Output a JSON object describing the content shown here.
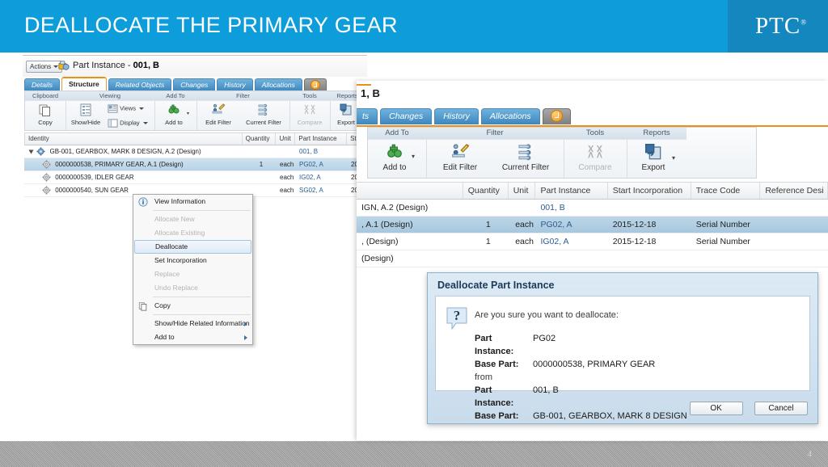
{
  "slide": {
    "title": "DEALLOCATE THE PRIMARY GEAR",
    "logo": "PTC",
    "logo_mark": "®",
    "page_number": "4",
    "banner_color": "#0d9ddb",
    "banner_accent_color": "#1387be",
    "footer_color": "#a6a6a6"
  },
  "background_window": {
    "actions_button": "Actions",
    "page_title_prefix": "Part Instance - ",
    "page_title_object": "001, B",
    "object_icon": "part-instance-icon",
    "tabs": [
      {
        "label": "Details",
        "active": false
      },
      {
        "label": "Structure",
        "active": true
      },
      {
        "label": "Related Objects",
        "active": false
      },
      {
        "label": "Changes",
        "active": false
      },
      {
        "label": "History",
        "active": false
      },
      {
        "label": "Allocations",
        "active": false
      }
    ],
    "tab_overflow_icon": "orange-circle-icon",
    "ribbon_groups": [
      {
        "name": "Clipboard",
        "items": [
          {
            "label": "Copy",
            "icon": "copy-icon",
            "disabled": false,
            "split": false
          }
        ]
      },
      {
        "name": "Viewing",
        "items": [
          {
            "label": "Show/Hide",
            "icon": "show-hide-icon",
            "disabled": false,
            "split": false
          },
          {
            "label": "Views",
            "icon": "views-icon",
            "disabled": false,
            "split": true
          },
          {
            "label": "Display",
            "icon": "display-icon",
            "disabled": false,
            "split": true
          }
        ]
      },
      {
        "name": "Add To",
        "items": [
          {
            "label": "Add to",
            "icon": "add-to-icon",
            "disabled": false,
            "split": true
          }
        ]
      },
      {
        "name": "Filter",
        "items": [
          {
            "label": "Edit Filter",
            "icon": "edit-filter-icon",
            "disabled": false,
            "split": false
          },
          {
            "label": "Current Filter",
            "icon": "current-filter-icon",
            "disabled": false,
            "split": false
          }
        ]
      },
      {
        "name": "Tools",
        "items": [
          {
            "label": "Compare",
            "icon": "compare-icon",
            "disabled": true,
            "split": false
          }
        ]
      },
      {
        "name": "Reports",
        "items": [
          {
            "label": "Export",
            "icon": "export-icon",
            "disabled": false,
            "split": true
          }
        ]
      }
    ],
    "table": {
      "headers": [
        "Identity",
        "Quantity",
        "Unit",
        "Part Instance",
        "Sta"
      ],
      "rows": [
        {
          "identity": "GB-001, GEARBOX, MARK 8 DESIGN, A.2 (Design)",
          "quantity": "",
          "unit": "",
          "part_instance": "001, B",
          "start": "",
          "level": 0,
          "selected": false,
          "expander": true
        },
        {
          "identity": "0000000538, PRIMARY GEAR, A.1 (Design)",
          "quantity": "1",
          "unit": "each",
          "part_instance": "PG02, A",
          "start": "20",
          "level": 1,
          "selected": true,
          "expander": false
        },
        {
          "identity": "0000000539, IDLER GEAR",
          "quantity": "",
          "unit": "each",
          "part_instance": "IG02, A",
          "start": "20",
          "level": 1,
          "selected": false,
          "expander": false
        },
        {
          "identity": "0000000540, SUN GEAR",
          "quantity": "",
          "unit": "each",
          "part_instance": "SG02, A",
          "start": "20",
          "level": 1,
          "selected": false,
          "expander": false
        }
      ]
    }
  },
  "context_menu": {
    "items": [
      {
        "label": "View Information",
        "disabled": false,
        "highlighted": false,
        "icon": "info-icon",
        "submenu": false
      },
      {
        "label": "Allocate New",
        "disabled": true,
        "highlighted": false,
        "icon": "",
        "submenu": false
      },
      {
        "label": "Allocate Existing",
        "disabled": true,
        "highlighted": false,
        "icon": "",
        "submenu": false
      },
      {
        "label": "Deallocate",
        "disabled": false,
        "highlighted": true,
        "icon": "",
        "submenu": false
      },
      {
        "label": "Set Incorporation",
        "disabled": false,
        "highlighted": false,
        "icon": "",
        "submenu": false
      },
      {
        "label": "Replace",
        "disabled": true,
        "highlighted": false,
        "icon": "",
        "submenu": false
      },
      {
        "label": "Undo Replace",
        "disabled": true,
        "highlighted": false,
        "icon": "",
        "submenu": false
      },
      {
        "label": "Copy",
        "disabled": false,
        "highlighted": false,
        "icon": "copy-icon",
        "submenu": false
      },
      {
        "label": "Show/Hide Related Information",
        "disabled": false,
        "highlighted": false,
        "icon": "",
        "submenu": true
      },
      {
        "label": "Add to",
        "disabled": false,
        "highlighted": false,
        "icon": "",
        "submenu": true
      }
    ]
  },
  "foreground_window": {
    "page_title_object": "1, B",
    "tabs": [
      {
        "label": "ts",
        "active": false
      },
      {
        "label": "Changes",
        "active": false
      },
      {
        "label": "History",
        "active": false
      },
      {
        "label": "Allocations",
        "active": false
      }
    ],
    "tab_overflow_icon": "orange-circle-icon",
    "ribbon_groups": [
      {
        "name": "Add To",
        "items": [
          {
            "label": "Add to",
            "icon": "add-to-icon",
            "disabled": false,
            "split": true
          }
        ]
      },
      {
        "name": "Filter",
        "items": [
          {
            "label": "Edit Filter",
            "icon": "edit-filter-icon",
            "disabled": false,
            "split": false
          },
          {
            "label": "Current Filter",
            "icon": "current-filter-icon",
            "disabled": false,
            "split": false
          }
        ]
      },
      {
        "name": "Tools",
        "items": [
          {
            "label": "Compare",
            "icon": "compare-icon",
            "disabled": true,
            "split": false
          }
        ]
      },
      {
        "name": "Reports",
        "items": [
          {
            "label": "Export",
            "icon": "export-icon",
            "disabled": false,
            "split": true
          }
        ]
      }
    ],
    "table": {
      "headers": [
        "",
        "Quantity",
        "Unit",
        "Part Instance",
        "Start Incorporation",
        "Trace Code",
        "Reference Desi"
      ],
      "rows": [
        {
          "identity": "IGN, A.2 (Design)",
          "quantity": "",
          "unit": "",
          "part_instance": "001, B",
          "start_incorporation": "",
          "trace_code": "",
          "reference_designator": "",
          "selected": false
        },
        {
          "identity": ", A.1 (Design)",
          "quantity": "1",
          "unit": "each",
          "part_instance": "PG02, A",
          "start_incorporation": "2015-12-18",
          "trace_code": "Serial Number",
          "reference_designator": "",
          "selected": true
        },
        {
          "identity": ", (Design)",
          "quantity": "1",
          "unit": "each",
          "part_instance": "IG02, A",
          "start_incorporation": "2015-12-18",
          "trace_code": "Serial Number",
          "reference_designator": "",
          "selected": false
        },
        {
          "identity": "(Design)",
          "quantity": "",
          "unit": "",
          "part_instance": "",
          "start_incorporation": "",
          "trace_code": "",
          "reference_designator": "",
          "selected": false
        }
      ]
    }
  },
  "dialog": {
    "title": "Deallocate Part Instance",
    "icon": "question-mark-icon",
    "question": "Are you sure you want to deallocate:",
    "source": {
      "part_instance_label": "Part Instance:",
      "part_instance_value": "PG02",
      "base_part_label": "Base Part:",
      "base_part_value": "0000000538, PRIMARY GEAR"
    },
    "connector": "from",
    "target": {
      "part_instance_label": "Part Instance:",
      "part_instance_value": "001, B",
      "base_part_label": "Base Part:",
      "base_part_value": "GB-001, GEARBOX, MARK 8 DESIGN"
    },
    "ok_label": "OK",
    "cancel_label": "Cancel"
  }
}
